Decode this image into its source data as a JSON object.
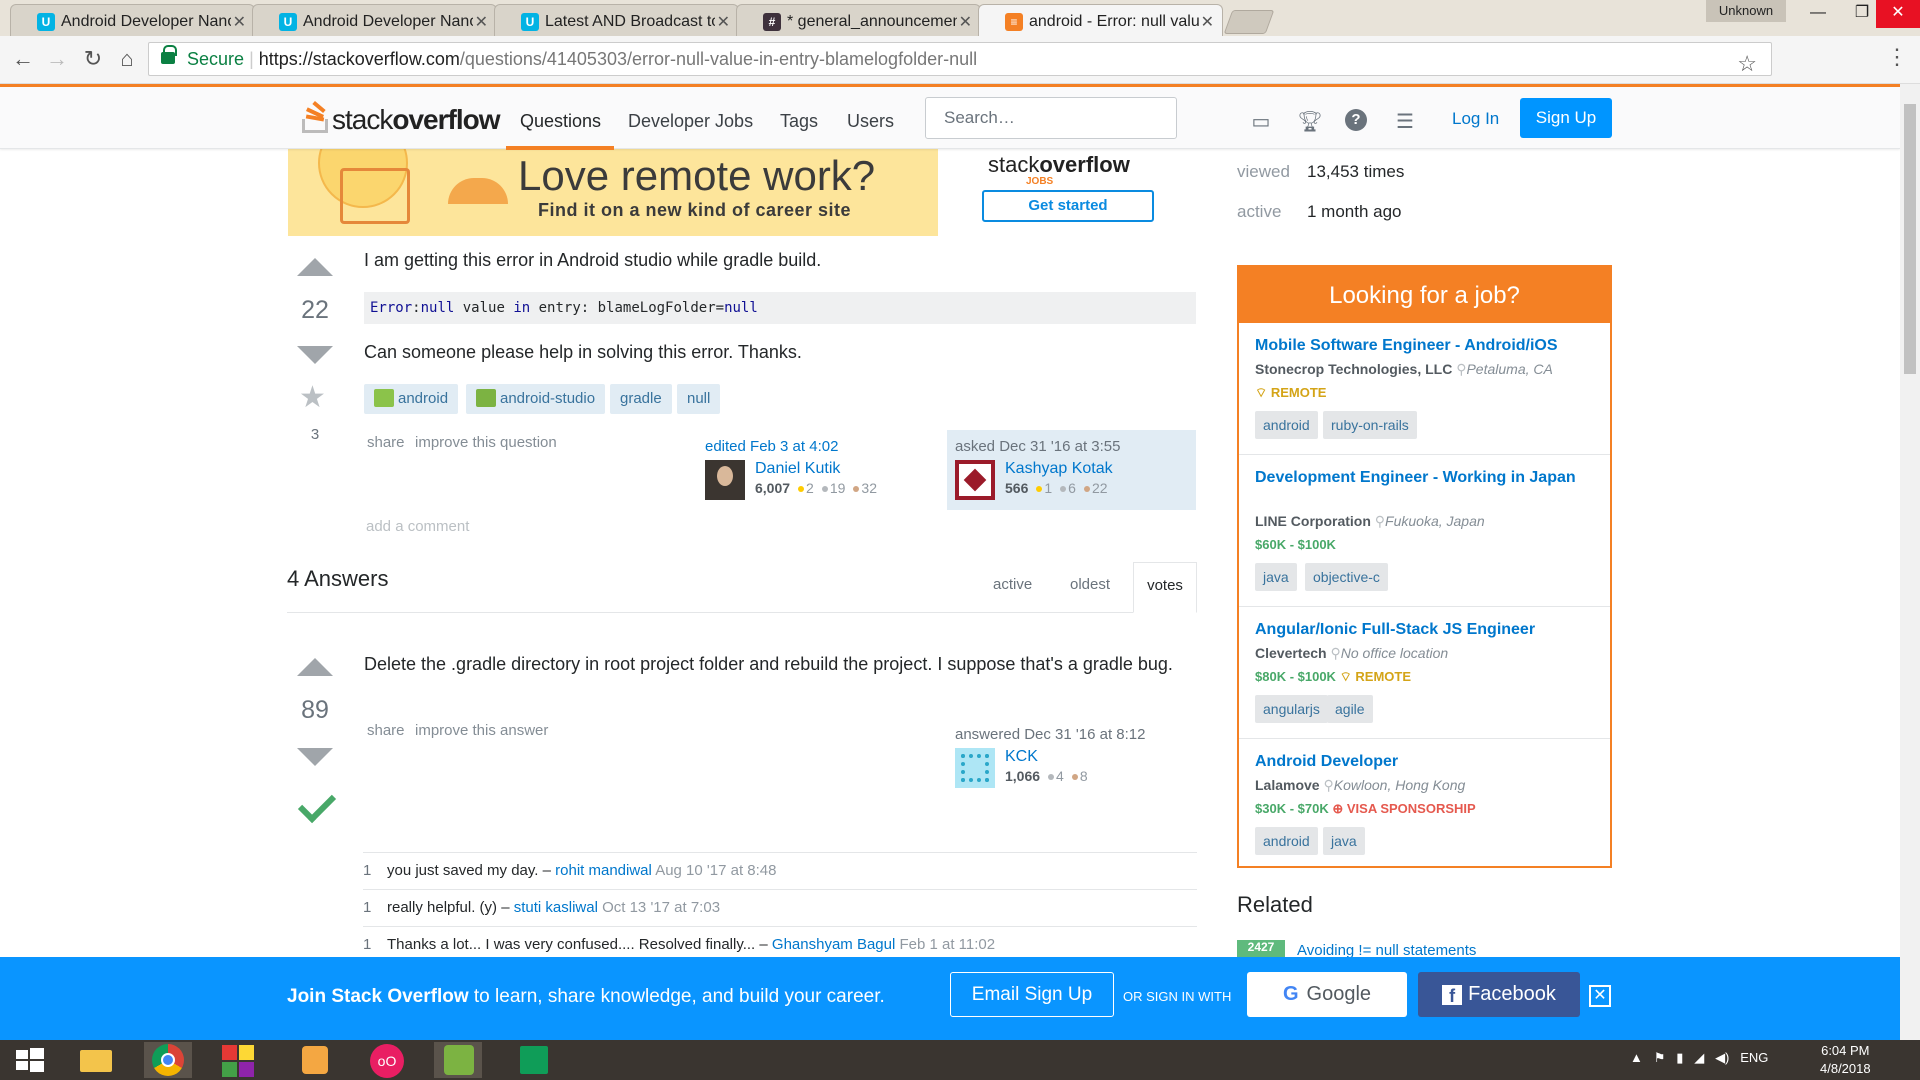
{
  "browser": {
    "tabs": [
      {
        "title": "Android Developer Nanodegree",
        "icon": "udacity-icon",
        "color": "#02b3e4"
      },
      {
        "title": "Android Developer Nanodegree",
        "icon": "udacity-icon",
        "color": "#02b3e4"
      },
      {
        "title": "Latest AND Broadcast topics",
        "icon": "udacity-icon",
        "color": "#02b3e4"
      },
      {
        "title": "* general_announcements",
        "icon": "slack-icon",
        "color": "#3e313c"
      },
      {
        "title": "android - Error: null value",
        "icon": "stackoverflow-icon",
        "color": "#f48024"
      }
    ],
    "profile": "Unknown",
    "secure_label": "Secure",
    "url_host": "https://stackoverflow.com",
    "url_path": "/questions/41405303/error-null-value-in-entry-blamelogfolder-null"
  },
  "so_header": {
    "logo_light": "stack",
    "logo_bold": "overflow",
    "nav": [
      "Questions",
      "Developer Jobs",
      "Tags",
      "Users"
    ],
    "search_placeholder": "Search…",
    "login": "Log In",
    "signup": "Sign Up"
  },
  "ad": {
    "title": "Love remote work?",
    "subtitle": "Find it on a new kind of career site",
    "logo_light": "stack",
    "logo_bold": "overflow",
    "logo_sub": "JOBS",
    "button": "Get started"
  },
  "question": {
    "votes": "22",
    "favorites": "3",
    "text1": "I am getting this error in Android studio while gradle build.",
    "code_kw1": "Error",
    "code_mid1": ":",
    "code_kw2": "null",
    "code_mid2": " value ",
    "code_kw3": "in",
    "code_mid3": " entry: blameLogFolder=",
    "code_kw4": "null",
    "text2": "Can someone please help in solving this error. Thanks.",
    "tags": [
      "android",
      "android-studio",
      "gradle",
      "null"
    ],
    "menu_share": "share",
    "menu_improve": "improve this question",
    "edited": "edited Feb 3 at 4:02",
    "editor": {
      "name": "Daniel Kutik",
      "rep": "6,007",
      "gold": "2",
      "silver": "19",
      "bronze": "32"
    },
    "asked": "asked Dec 31 '16 at 3:55",
    "owner": {
      "name": "Kashyap Kotak",
      "rep": "566",
      "gold": "1",
      "silver": "6",
      "bronze": "22"
    },
    "add_comment": "add a comment"
  },
  "answers": {
    "header": "4 Answers",
    "tabs": [
      "active",
      "oldest",
      "votes"
    ],
    "first": {
      "votes": "89",
      "text": "Delete the .gradle directory in root project folder and rebuild the project. I suppose that's a gradle bug.",
      "menu_share": "share",
      "menu_improve": "improve this answer",
      "answered": "answered Dec 31 '16 at 8:12",
      "user": {
        "name": "KCK",
        "rep": "1,066",
        "silver": "4",
        "bronze": "8"
      },
      "comments": [
        {
          "score": "1",
          "text": "you just saved my day. – ",
          "user": "rohit mandiwal",
          "date": " Aug 10 '17 at 8:48"
        },
        {
          "score": "1",
          "text": "really helpful. (y) – ",
          "user": "stuti kasliwal",
          "date": " Oct 13 '17 at 7:03"
        },
        {
          "score": "1",
          "text": "Thanks a lot... I was very confused.... Resolved finally... – ",
          "user": "Ghanshyam Bagul",
          "date": " Feb 1 at 11:02"
        }
      ]
    }
  },
  "sidebar": {
    "viewed_label": "viewed",
    "viewed": "13,453 times",
    "active_label": "active",
    "active": "1 month ago",
    "jobs_header": "Looking for a job?",
    "jobs": [
      {
        "title": "Mobile Software Engineer - Android/iOS",
        "company": "Stonecrop Technologies, LLC",
        "location": "Petaluma, CA",
        "salary": "",
        "remote": "REMOTE",
        "visa": "",
        "tags": [
          "android",
          "ruby-on-rails"
        ]
      },
      {
        "title": "Development Engineer - Working in Japan",
        "company": "LINE Corporation",
        "location": "Fukuoka, Japan",
        "salary": "$60K - $100K",
        "remote": "",
        "visa": "",
        "tags": [
          "java",
          "objective-c"
        ]
      },
      {
        "title": "Angular/Ionic Full-Stack JS Engineer",
        "company": "Clevertech",
        "location": "No office location",
        "salary": "$80K - $100K",
        "remote": "REMOTE",
        "visa": "",
        "tags": [
          "angularjs",
          "agile"
        ]
      },
      {
        "title": "Android Developer",
        "company": "Lalamove",
        "location": "Kowloon, Hong Kong",
        "salary": "$30K - $70K",
        "remote": "",
        "visa": "VISA SPONSORSHIP",
        "tags": [
          "android",
          "java"
        ]
      }
    ],
    "related_header": "Related",
    "related_count": "2427",
    "related_link": "Avoiding != null statements"
  },
  "joinbar": {
    "text_bold": "Join Stack Overflow",
    "text_rest": " to learn, share knowledge, and build your career.",
    "email": "Email Sign Up",
    "or": "OR SIGN IN WITH",
    "google_g": "G",
    "google": "Google",
    "facebook_f": "f",
    "facebook": "Facebook",
    "close": "✕"
  },
  "taskbar": {
    "lang": "ENG",
    "time": "6:04 PM",
    "date": "4/8/2018"
  }
}
